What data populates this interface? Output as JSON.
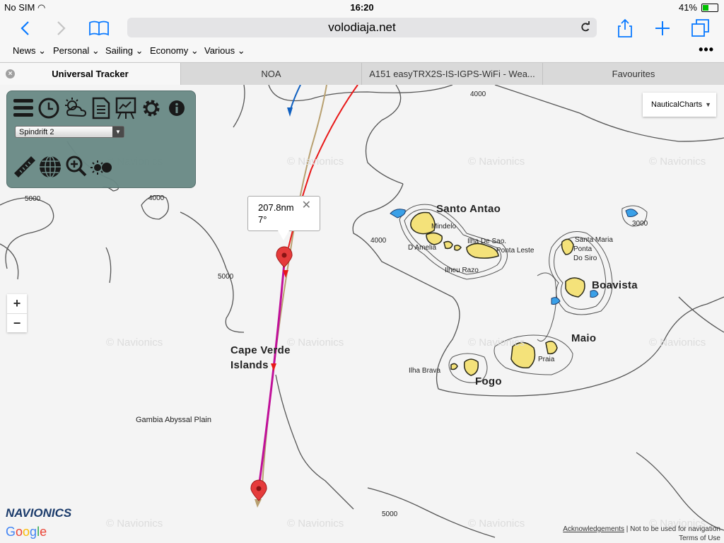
{
  "status_bar": {
    "carrier": "No SIM",
    "time": "16:20",
    "battery": "41%",
    "battery_level": 0.41
  },
  "browser": {
    "url": "volodiaja.net"
  },
  "bookmarks": [
    {
      "label": "News"
    },
    {
      "label": "Personal"
    },
    {
      "label": "Sailing"
    },
    {
      "label": "Economy"
    },
    {
      "label": "Various"
    }
  ],
  "tabs": [
    {
      "label": "Universal Tracker"
    },
    {
      "label": "NOA"
    },
    {
      "label": "A151 easyTRX2S-IS-IGPS-WiFi - Wea..."
    },
    {
      "label": "Favourites"
    }
  ],
  "tracker": {
    "boat_select": "Spindrift 2"
  },
  "map_type": "NauticalCharts",
  "popup": {
    "distance": "207.8nm",
    "bearing": "7°"
  },
  "zoom": {
    "in": "+",
    "out": "−"
  },
  "labels": {
    "islands": [
      "Santo Antao",
      "Boavista",
      "Maio",
      "Fogo",
      "Cape Verde",
      "Islands"
    ],
    "places": [
      "Mindelo",
      "Ilha De Sao.",
      "D Amelia",
      "Ponta Leste",
      "Ilheu Razo",
      "Santa Maria",
      "Ponta",
      "Do Siro",
      "Ilha Brava",
      "Praia"
    ],
    "region": "Gambia Abyssal Plain",
    "depths": [
      "4000",
      "5000",
      "4000",
      "5000",
      "4000",
      "3000",
      "5000"
    ]
  },
  "watermark": "© Navionics",
  "logo": {
    "navionics": "NAVIONICS",
    "google": "Google"
  },
  "footer": {
    "acknowledgements": "Acknowledgements",
    "disclaimer": "| Not to be used for navigation",
    "terms": "Terms of Use"
  },
  "colors": {
    "land": "#f4e27a",
    "shallow": "#3aa0e8",
    "track_magenta": "#c0109a",
    "track_red": "#e81818",
    "track_tan": "#b8a070",
    "track_blue": "#1060c0",
    "panel": "#6a8a86"
  }
}
